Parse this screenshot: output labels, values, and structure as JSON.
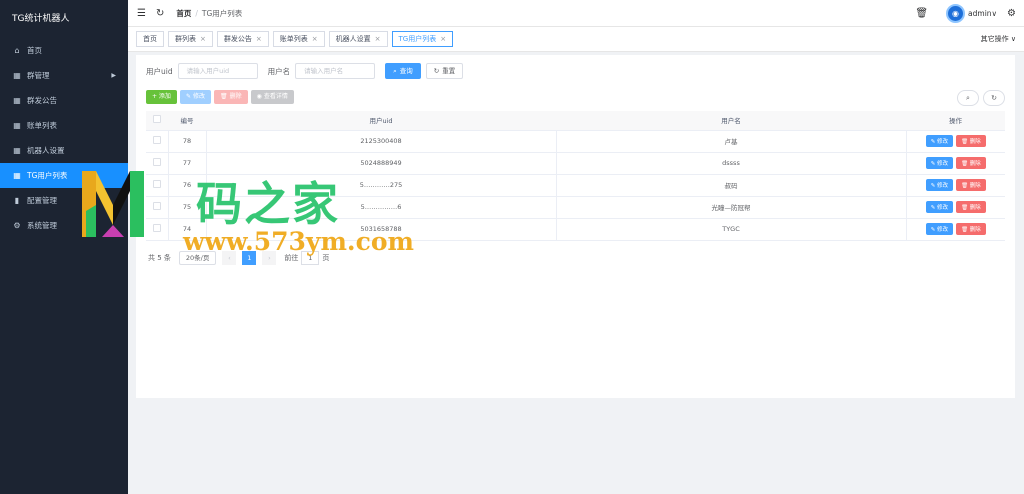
{
  "sidebar": {
    "brand": "TG统计机器人",
    "items": [
      {
        "label": "首页",
        "icon": "home-icon",
        "glyph": "⌂"
      },
      {
        "label": "群管理",
        "icon": "grid-icon",
        "glyph": "▦",
        "arrow": "▶"
      },
      {
        "label": "群发公告",
        "icon": "grid-icon",
        "glyph": "▦"
      },
      {
        "label": "账单列表",
        "icon": "grid-icon",
        "glyph": "▦"
      },
      {
        "label": "机器人设置",
        "icon": "grid-icon",
        "glyph": "▦"
      },
      {
        "label": "TG用户列表",
        "icon": "grid-icon",
        "glyph": "▦",
        "active": true
      },
      {
        "label": "配置管理",
        "icon": "chart-icon",
        "glyph": "▮"
      },
      {
        "label": "系统管理",
        "icon": "gear-icon",
        "glyph": "⚙"
      }
    ]
  },
  "navbar": {
    "breadcrumb_home": "首页",
    "breadcrumb_sep": "/",
    "breadcrumb_current": "TG用户列表",
    "username": "admin",
    "user_chevron": "∨"
  },
  "tags": {
    "items": [
      {
        "label": "首页",
        "closable": false
      },
      {
        "label": "群列表",
        "closable": true
      },
      {
        "label": "群发公告",
        "closable": true
      },
      {
        "label": "账单列表",
        "closable": true
      },
      {
        "label": "机器人设置",
        "closable": true
      },
      {
        "label": "TG用户列表",
        "closable": true,
        "active": true
      }
    ],
    "close_glyph": "×",
    "other_ops": "其它操作 ∨"
  },
  "search": {
    "uid_label": "用户uid",
    "uid_placeholder": "请输入用户uid",
    "name_label": "用户名",
    "name_placeholder": "请输入用户名",
    "search_btn": "查询",
    "reset_btn": "重置"
  },
  "toolbar": {
    "add": "+ 添加",
    "edit": "修改",
    "delete": "删除",
    "detail": "查看详情"
  },
  "table": {
    "headers": [
      "",
      "编号",
      "用户uid",
      "用户名",
      "操作"
    ],
    "rows": [
      {
        "id": "78",
        "uid": "2125300408",
        "name": "卢基"
      },
      {
        "id": "77",
        "uid": "5024888949",
        "name": "dssss"
      },
      {
        "id": "76",
        "uid": "5…………275",
        "name": "叔码"
      },
      {
        "id": "75",
        "uid": "5……………6",
        "name": "光瞳—防冠帮"
      },
      {
        "id": "74",
        "uid": "5031658788",
        "name": "TYGC"
      }
    ],
    "op_edit": "修改",
    "op_delete": "删除"
  },
  "pagination": {
    "total": "共 5 条",
    "page_size": "20条/页",
    "prev": "‹",
    "current": "1",
    "next": "›",
    "goto_label": "前往",
    "goto_value": "1",
    "goto_suffix": "页"
  },
  "watermark": {
    "title": "码之家",
    "url": "www.573ym.com"
  },
  "colors": {
    "sidebar_bg": "#1c2432",
    "primary": "#409eff",
    "danger": "#f56c6c",
    "success": "#67c23a"
  }
}
